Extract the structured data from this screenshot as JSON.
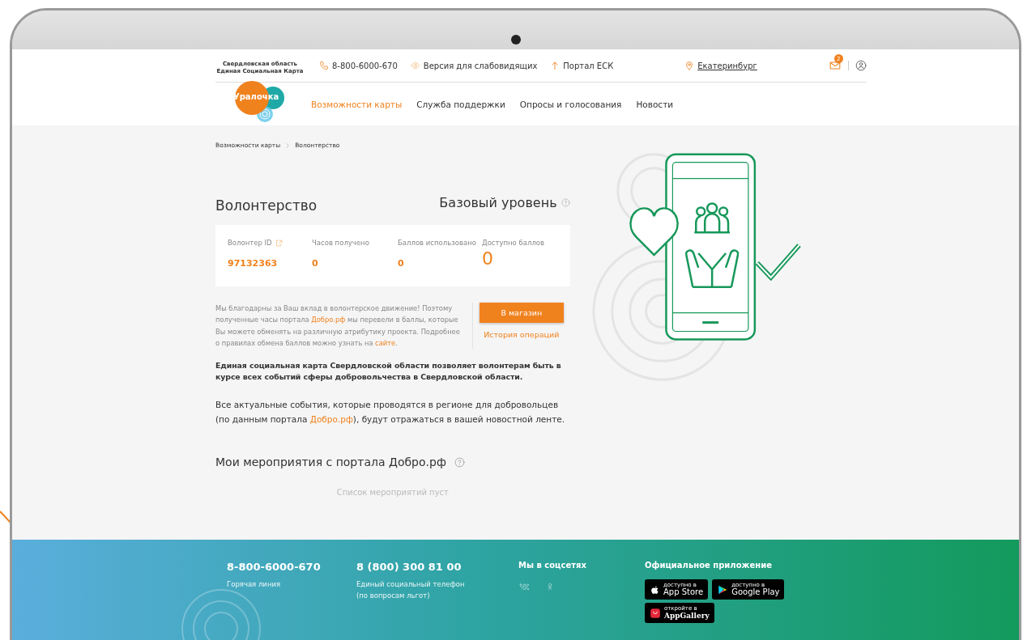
{
  "header": {
    "region_line1": "Свердловская область",
    "region_line2": "Единая Социальная Карта",
    "logo": "Уралочка",
    "phone": "8-800-6000-670",
    "low_vision": "Версия для слабовидящих",
    "portal": "Портал ЕСК",
    "city": "Екатеринбург",
    "mail_badge": "2"
  },
  "nav": [
    {
      "label": "Возможности карты",
      "selected": true
    },
    {
      "label": "Служба поддержки",
      "selected": false
    },
    {
      "label": "Опросы и голосования",
      "selected": false
    },
    {
      "label": "Новости",
      "selected": false
    }
  ],
  "breadcrumbs": [
    "Возможности карты",
    "Волонтерство"
  ],
  "title": "Волонтерство",
  "level_title": "Базовый уровень",
  "stats": [
    {
      "kind": "id",
      "label": "Волонтер ID",
      "value": "97132363"
    },
    {
      "kind": "plain",
      "label": "Часов получено",
      "value": "0"
    },
    {
      "kind": "plain",
      "label": "Баллов использовано",
      "value": "0"
    },
    {
      "kind": "big",
      "label": "Доступно баллов",
      "value": "0"
    }
  ],
  "info_parts": [
    {
      "kind": "text",
      "text": "Мы благодарны за Ваш вклад в волонтерское движение! Поэтому полученные часы портала "
    },
    {
      "kind": "link",
      "text": "Добро.рф"
    },
    {
      "kind": "text",
      "text": " мы перевели в баллы, которые Вы можете обменять на различную атрибутику проекта. Подробнее о правилах обмена баллов можно узнать на "
    },
    {
      "kind": "link",
      "text": "сайте"
    },
    {
      "kind": "text",
      "text": "."
    }
  ],
  "shop_button": "В магазин",
  "history_link": "История операций",
  "bold_text": "Единая социальная карта Свердловской области позволяет волонтерам быть в курсе всех событий сферы добровольчества в Свердловской области.",
  "events_parts": [
    {
      "kind": "text",
      "text": "Все актуальные события, которые проводятся в регионе для добровольцев (по данным портала "
    },
    {
      "kind": "link",
      "text": "Добро.рф"
    },
    {
      "kind": "text",
      "text": "), будут отражаться в вашей новостной ленте."
    }
  ],
  "my_events_title": "Мои мероприятия с портала Добро.рф",
  "empty_text": "Список мероприятий пуст",
  "footer": {
    "contacts": [
      {
        "phone": "8-800-6000-670",
        "caption": "Горячая линия"
      },
      {
        "phone": "8 (800) 300 81 00",
        "caption": "Единый социальный телефон (по вопросам льгот)"
      }
    ],
    "social_title": "Мы в соцсетях",
    "app_title": "Официальное приложение",
    "stores": [
      {
        "kind": "apple",
        "small": "доступно в",
        "name": "App Store"
      },
      {
        "kind": "google",
        "small": "доступно в",
        "name": "Google Play"
      },
      {
        "kind": "huawei",
        "small": "откройте в",
        "name": "AppGallery"
      }
    ]
  }
}
